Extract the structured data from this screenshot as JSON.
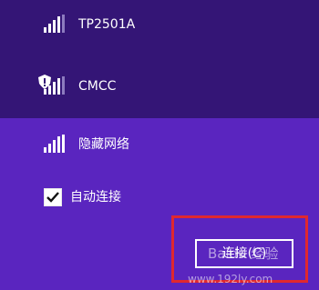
{
  "networks": [
    {
      "name": "TP2501A",
      "signal": 4,
      "secured": false
    },
    {
      "name": "CMCC",
      "signal": 4,
      "secured": true
    },
    {
      "name": "隐藏网络",
      "signal": 4,
      "secured": false
    }
  ],
  "auto_connect": {
    "label": "自动连接",
    "checked": true
  },
  "connect_button": {
    "label": "连接(C)"
  },
  "watermark": {
    "text": "Baidu 经验",
    "url": "www.192ly.com"
  },
  "colors": {
    "top_panel": "#341576",
    "selected_panel": "#5a25bf",
    "highlight_border": "#e0282f",
    "text": "#ffffff"
  },
  "icons": [
    "wifi-signal-icon",
    "shield-warning-icon",
    "checkmark-icon"
  ]
}
